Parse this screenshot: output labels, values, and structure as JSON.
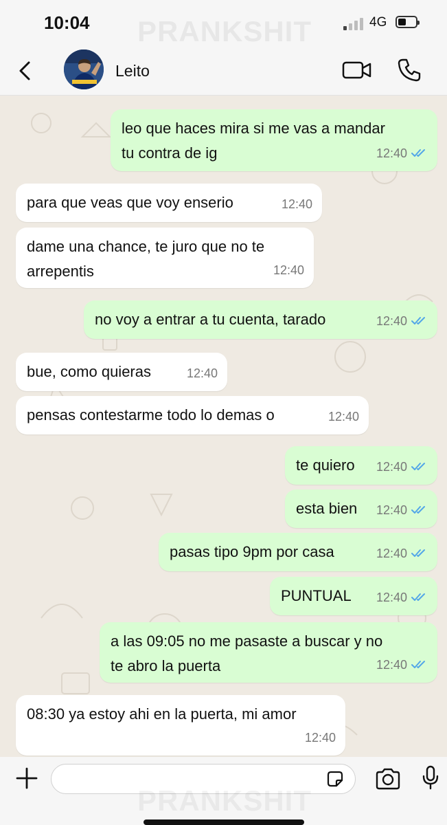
{
  "status_bar": {
    "time": "10:04",
    "network": "4G"
  },
  "watermark": "PRANKSHIT",
  "header": {
    "contact_name": "Leito"
  },
  "colors": {
    "outgoing_bubble": "#d9fdd3",
    "incoming_bubble": "#ffffff",
    "chat_background": "#efeae2",
    "read_ticks": "#53a6e8"
  },
  "messages": [
    {
      "direction": "out",
      "lines": [
        "leo que haces mira si me vas a mandar",
        "tu contra de ig"
      ],
      "time": "12:40",
      "status": "read"
    },
    {
      "direction": "in",
      "lines": [
        "para que veas que voy enserio"
      ],
      "time": "12:40"
    },
    {
      "direction": "in",
      "lines": [
        "dame una chance, te juro que no te",
        "arrepentis"
      ],
      "time": "12:40"
    },
    {
      "direction": "out",
      "lines": [
        "no voy a entrar a tu cuenta, tarado"
      ],
      "time": "12:40",
      "status": "read"
    },
    {
      "direction": "in",
      "lines": [
        "bue, como quieras"
      ],
      "time": "12:40"
    },
    {
      "direction": "in",
      "lines": [
        "pensas contestarme todo lo demas o"
      ],
      "time": "12:40"
    },
    {
      "direction": "out",
      "lines": [
        "te quiero"
      ],
      "time": "12:40",
      "status": "read"
    },
    {
      "direction": "out",
      "lines": [
        "esta bien"
      ],
      "time": "12:40",
      "status": "read"
    },
    {
      "direction": "out",
      "lines": [
        "pasas tipo 9pm por casa"
      ],
      "time": "12:40",
      "status": "read"
    },
    {
      "direction": "out",
      "lines": [
        "PUNTUAL"
      ],
      "time": "12:40",
      "status": "read"
    },
    {
      "direction": "out",
      "lines": [
        "a las 09:05 no me pasaste a buscar y no",
        "te abro la puerta"
      ],
      "time": "12:40",
      "status": "read"
    },
    {
      "direction": "in",
      "lines": [
        "08:30 ya estoy ahi en la puerta, mi amor"
      ],
      "time": "12:40"
    }
  ],
  "input": {
    "value": ""
  },
  "icons": [
    "back-chevron-icon",
    "video-call-icon",
    "phone-icon",
    "plus-icon",
    "sticker-icon",
    "camera-icon",
    "mic-icon",
    "double-check-icon"
  ]
}
